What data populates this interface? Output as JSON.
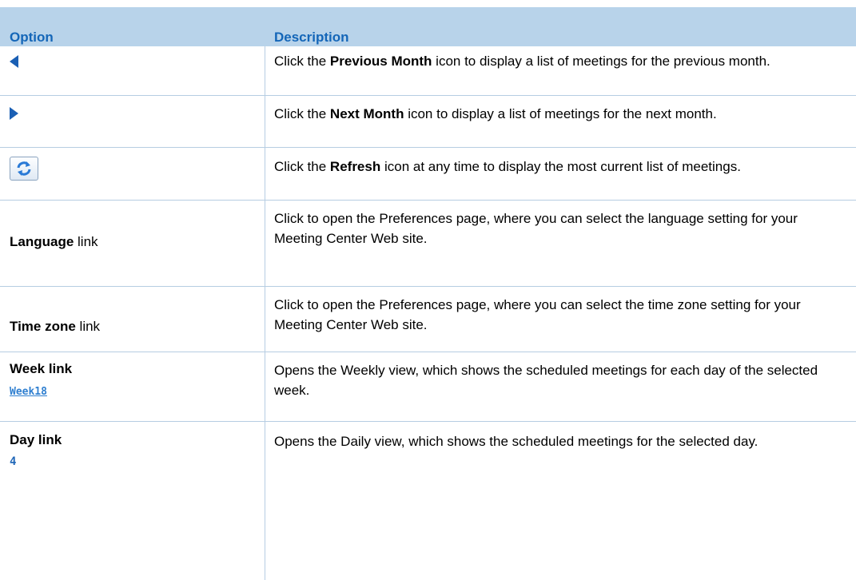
{
  "table": {
    "header": {
      "option": "Option",
      "description": "Description"
    },
    "rows": [
      {
        "desc_pre": "Click the ",
        "desc_bold": "Previous Month",
        "desc_post": " icon to display a list of meetings for the previous month."
      },
      {
        "desc_pre": "Click the ",
        "desc_bold": "Next Month",
        "desc_post": " icon to display a list of meetings for the next month."
      },
      {
        "desc_pre": "Click the ",
        "desc_bold": "Refresh",
        "desc_post": " icon at any time to display the most current list of meetings."
      },
      {
        "opt_bold": "Language",
        "opt_post": " link",
        "desc": "Click to open the Preferences page, where you can select the language setting for your Meeting Center Web site."
      },
      {
        "opt_bold": "Time zone",
        "opt_post": " link",
        "desc": "Click to open the Preferences page, where you can select the time zone setting for your Meeting Center Web site."
      },
      {
        "opt_bold": "Week link",
        "opt_sample": "Week18",
        "desc": "Opens the Weekly view, which shows the scheduled meetings for each day of the selected week."
      },
      {
        "opt_bold": "Day link",
        "opt_sample": "4",
        "desc": "Opens the Daily view, which shows the scheduled meetings for the selected day."
      }
    ]
  },
  "icons": {
    "previous": "triangle-left",
    "next": "triangle-right",
    "refresh": "refresh-arrows"
  },
  "colors": {
    "header_bg": "#b8d3ea",
    "header_text": "#1466b8",
    "rule": "#b6cde2",
    "icon_blue": "#1a5fb4",
    "link_blue": "#2f7fd0"
  }
}
